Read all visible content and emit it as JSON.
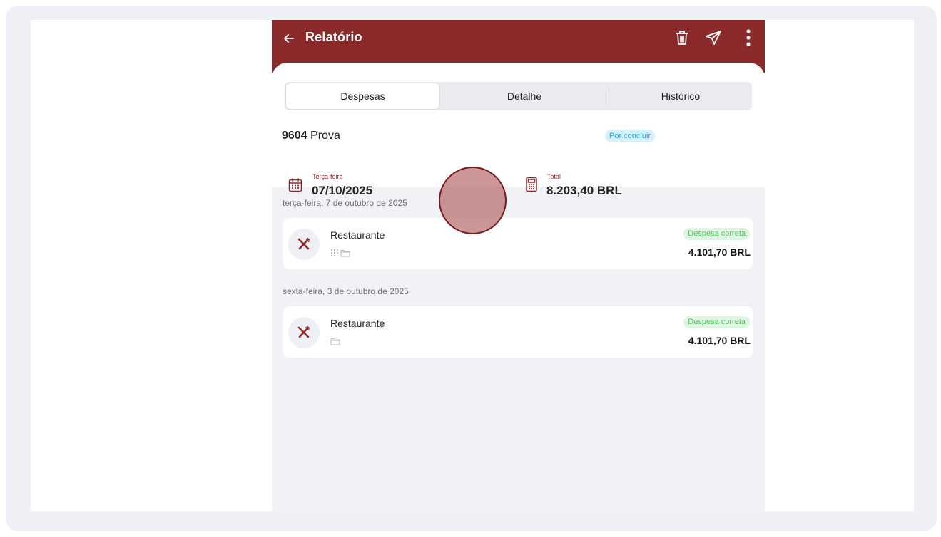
{
  "header": {
    "title": "Relatório",
    "back_icon": "arrow-left-icon",
    "actions": [
      "trash-icon",
      "send-icon",
      "more-vertical-icon"
    ],
    "color": "#8b2a2b"
  },
  "tabs": [
    {
      "label": "Despesas",
      "active": true
    },
    {
      "label": "Detalhe",
      "active": false
    },
    {
      "label": "Histórico",
      "active": false
    }
  ],
  "report": {
    "number": "9604",
    "name": "Prova",
    "status": "Por concluir",
    "date_caption": "Terça-feira",
    "date_value": "07/10/2025",
    "total_caption": "Total",
    "total_value": "8.203,40 BRL"
  },
  "groups": [
    {
      "date_label": "terça-feira, 7 de outubro de 2025",
      "expenses": [
        {
          "category": "Restaurante",
          "icon": "fork-knife-icon",
          "status": "Despesa correta",
          "amount": "4.101,70 BRL",
          "meta_icons": [
            "grid-icon",
            "folder-icon"
          ]
        }
      ]
    },
    {
      "date_label": "sexta-feira, 3 de outubro de 2025",
      "expenses": [
        {
          "category": "Restaurante",
          "icon": "fork-knife-icon",
          "status": "Despesa correta",
          "amount": "4.101,70 BRL",
          "meta_icons": [
            "folder-icon"
          ]
        }
      ]
    }
  ],
  "colors": {
    "status_pending_bg": "#d7f1fa",
    "status_pending_text": "#2da7cf",
    "status_ok_bg": "#dff6e2",
    "status_ok_text": "#48c95b"
  }
}
